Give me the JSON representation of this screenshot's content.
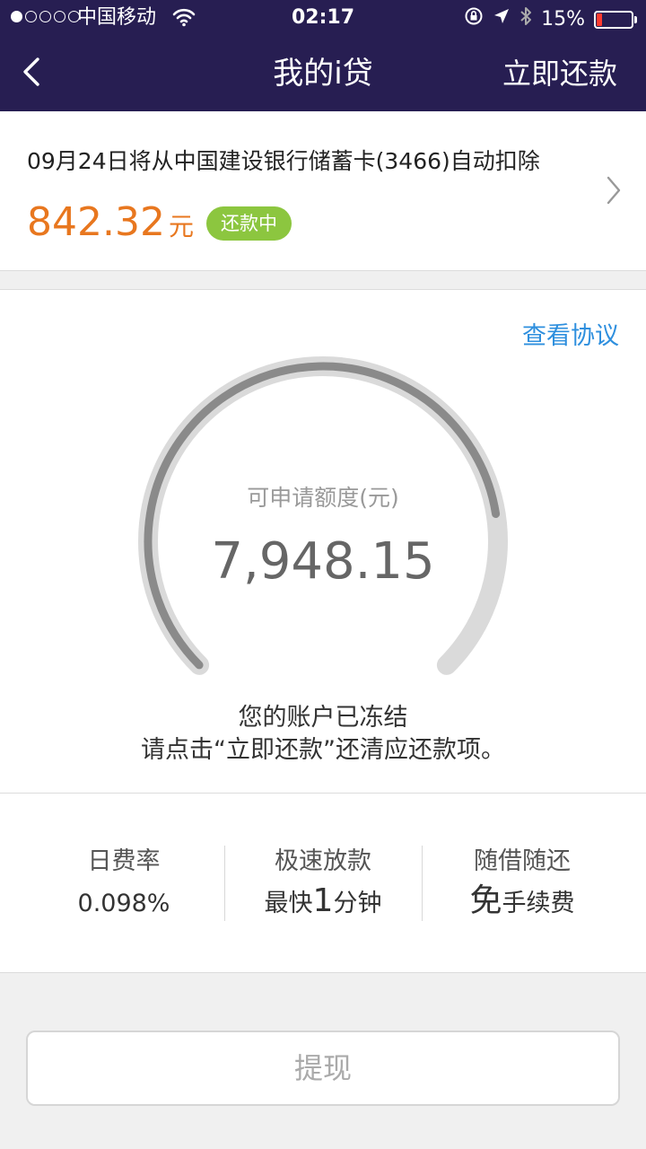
{
  "status_bar": {
    "carrier": "中国移动",
    "time": "02:17",
    "battery_percent": "15%",
    "battery_level": 0.15,
    "signal_bars_filled": 1,
    "signal_bars_total": 5
  },
  "nav": {
    "title": "我的i贷",
    "action_label": "立即还款"
  },
  "bill": {
    "description": "09月24日将从中国建设银行储蓄卡(3466)自动扣除",
    "amount": "842.32",
    "unit": "元",
    "status_badge": "还款中"
  },
  "credit": {
    "agreement_link": "查看协议",
    "label": "可申请额度(元)",
    "value": "7,948.15",
    "gauge_fill_fraction": 0.8,
    "frozen_line1": "您的账户已冻结",
    "frozen_line2": "请点击“立即还款”还清应还款项。"
  },
  "features": [
    {
      "title": "日费率",
      "value_prefix": "",
      "value_big": "",
      "value_text": "0.098%"
    },
    {
      "title": "极速放款",
      "value_prefix": "最快",
      "value_big": "1",
      "value_text": "分钟"
    },
    {
      "title": "随借随还",
      "value_prefix": "",
      "value_big": "免",
      "value_text": "手续费"
    }
  ],
  "withdraw_button": "提现",
  "colors": {
    "nav_background": "#271e52",
    "amount_orange": "#e8771f",
    "badge_green": "#8cc63f",
    "link_blue": "#2e8fde",
    "battery_red": "#ff3b30"
  },
  "icons": {
    "wifi": "wifi-icon",
    "lock_rotation": "rotation-lock-icon",
    "location": "location-arrow-icon",
    "bluetooth": "bluetooth-icon",
    "battery": "battery-icon",
    "back": "chevron-left-icon",
    "chevron_right": "chevron-right-icon"
  }
}
